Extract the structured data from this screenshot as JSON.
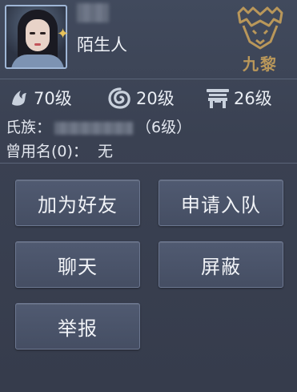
{
  "profile": {
    "name": "陌生人",
    "star_icon": "star-icon",
    "guild_logo_text": "九黎",
    "guild_logo_color": "#b9975a"
  },
  "stats": {
    "level1": "70级",
    "level2": "20级",
    "level3": "26级"
  },
  "info": {
    "clan_label": "氏族：",
    "clan_suffix": "（6级）",
    "former_names_label": "曾用名(0)：",
    "former_names_value": "无"
  },
  "actions": {
    "add_friend": "加为好友",
    "join_team": "申请入队",
    "chat": "聊天",
    "block": "屏蔽",
    "report": "举报"
  },
  "colors": {
    "background": "#3b4254",
    "button_bg": "#4b5469",
    "button_border": "#6c7790",
    "text": "#e6e9ef"
  }
}
